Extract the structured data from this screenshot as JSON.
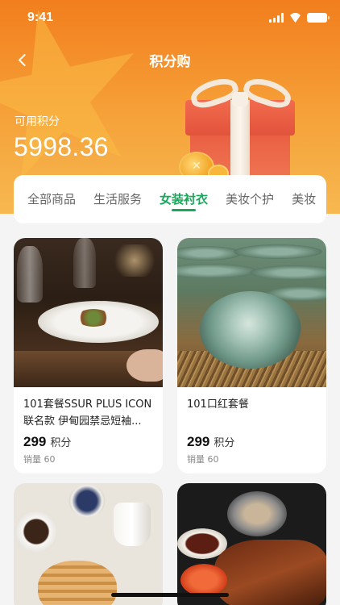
{
  "status_bar": {
    "time": "9:41"
  },
  "nav": {
    "title": "积分购"
  },
  "points": {
    "label": "可用积分",
    "value": "5998.36"
  },
  "tabs": [
    {
      "label": "全部商品",
      "active": false
    },
    {
      "label": "生活服务",
      "active": false
    },
    {
      "label": "女装衬衣",
      "active": true
    },
    {
      "label": "美妆个护",
      "active": false
    },
    {
      "label": "美妆",
      "active": false
    }
  ],
  "products": [
    {
      "title": "101套餐SSUR PLUS ICON联名款 伊甸园禁忌短袖...",
      "price": "299",
      "unit": "积分",
      "sales": "销量 60"
    },
    {
      "title": "101口红套餐",
      "price": "299",
      "unit": "积分",
      "sales": "销量 60"
    }
  ],
  "colors": {
    "accent": "#17a85b",
    "header_top": "#f27e1d",
    "header_bottom": "#f7b850"
  }
}
